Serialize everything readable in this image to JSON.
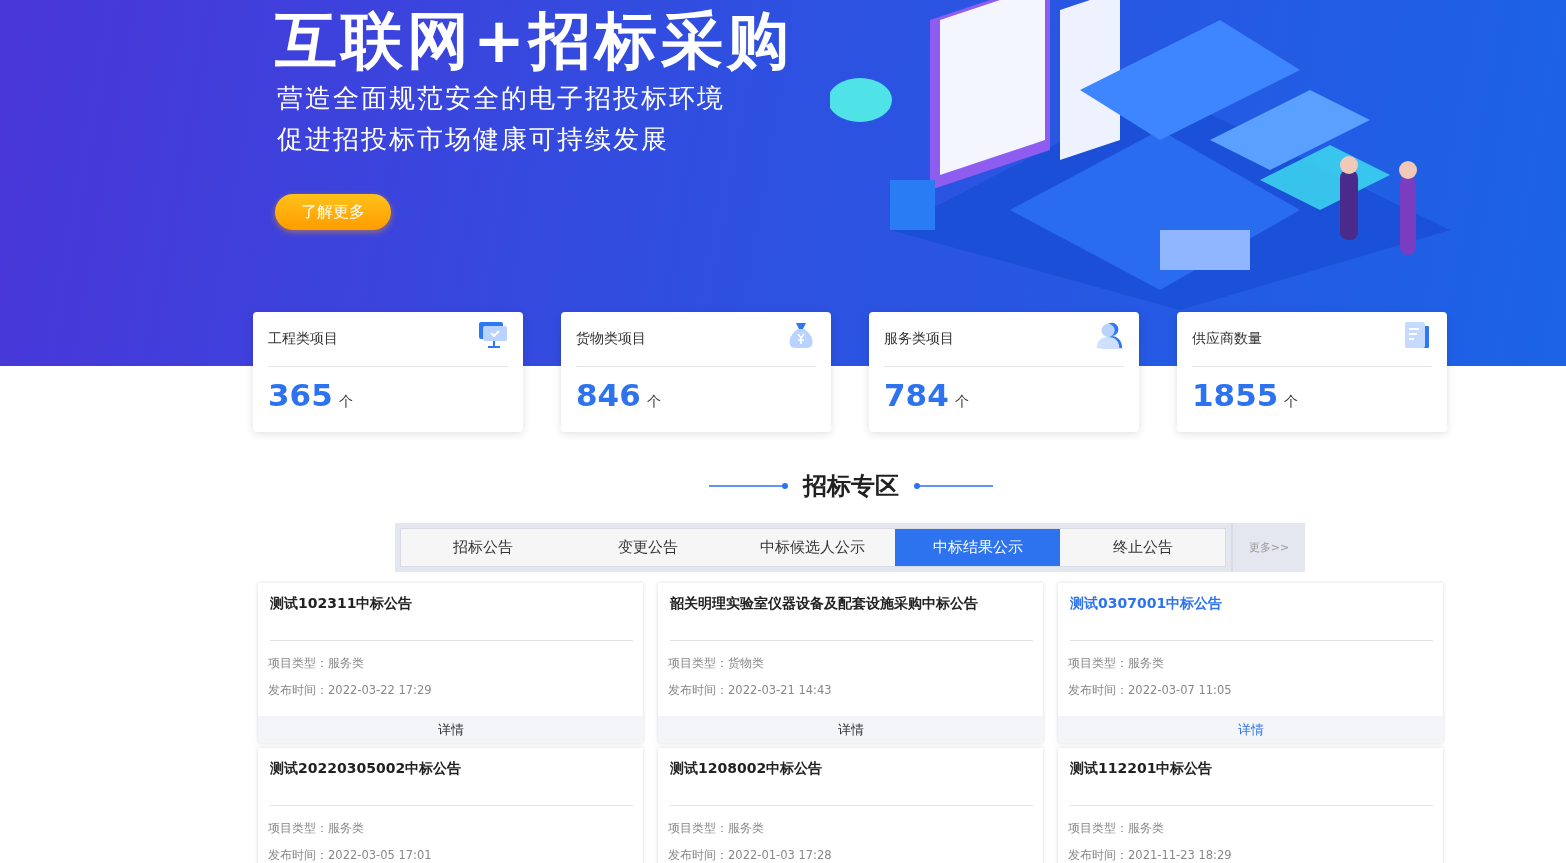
{
  "banner": {
    "headline": "互联网+招标采购",
    "lines": [
      "营造全面规范安全的电子招投标环境",
      "促进招投标市场健康可持续发展"
    ],
    "button": "了解更多"
  },
  "stats": [
    {
      "label": "工程类项目",
      "value": "365",
      "unit": "个",
      "kind": "monitor"
    },
    {
      "label": "货物类项目",
      "value": "846",
      "unit": "个",
      "kind": "moneybag"
    },
    {
      "label": "服务类项目",
      "value": "784",
      "unit": "个",
      "kind": "person"
    },
    {
      "label": "供应商数量",
      "value": "1855",
      "unit": "个",
      "kind": "document"
    }
  ],
  "section_title": "招标专区",
  "tabs": [
    {
      "label": "招标公告",
      "selected": false
    },
    {
      "label": "变更公告",
      "selected": false
    },
    {
      "label": "中标候选人公示",
      "selected": false
    },
    {
      "label": "中标结果公示",
      "selected": true
    },
    {
      "label": "终止公告",
      "selected": false
    }
  ],
  "more_link": "更多>>",
  "notices": [
    {
      "title": "测试102311中标公告",
      "type_label": "项目类型：",
      "type": "服务类",
      "time_label": "发布时间：",
      "time": "2022-03-22 17:29",
      "detail": "详情",
      "selected": false
    },
    {
      "title": "韶关明理实验室仪器设备及配套设施采购中标公告",
      "type_label": "项目类型：",
      "type": "货物类",
      "time_label": "发布时间：",
      "time": "2022-03-21 14:43",
      "detail": "详情",
      "selected": false
    },
    {
      "title": "测试0307001中标公告",
      "type_label": "项目类型：",
      "type": "服务类",
      "time_label": "发布时间：",
      "time": "2022-03-07 11:05",
      "detail": "详情",
      "selected": true
    },
    {
      "title": "测试20220305002中标公告",
      "type_label": "项目类型：",
      "type": "服务类",
      "time_label": "发布时间：",
      "time": "2022-03-05 17:01",
      "selected": false
    },
    {
      "title": "测试1208002中标公告",
      "type_label": "项目类型：",
      "type": "服务类",
      "time_label": "发布时间：",
      "time": "2022-01-03 17:28",
      "selected": false
    },
    {
      "title": "测试112201中标公告",
      "type_label": "项目类型：",
      "type": "服务类",
      "time_label": "发布时间：",
      "time": "2021-11-23 18:29",
      "selected": false
    }
  ]
}
